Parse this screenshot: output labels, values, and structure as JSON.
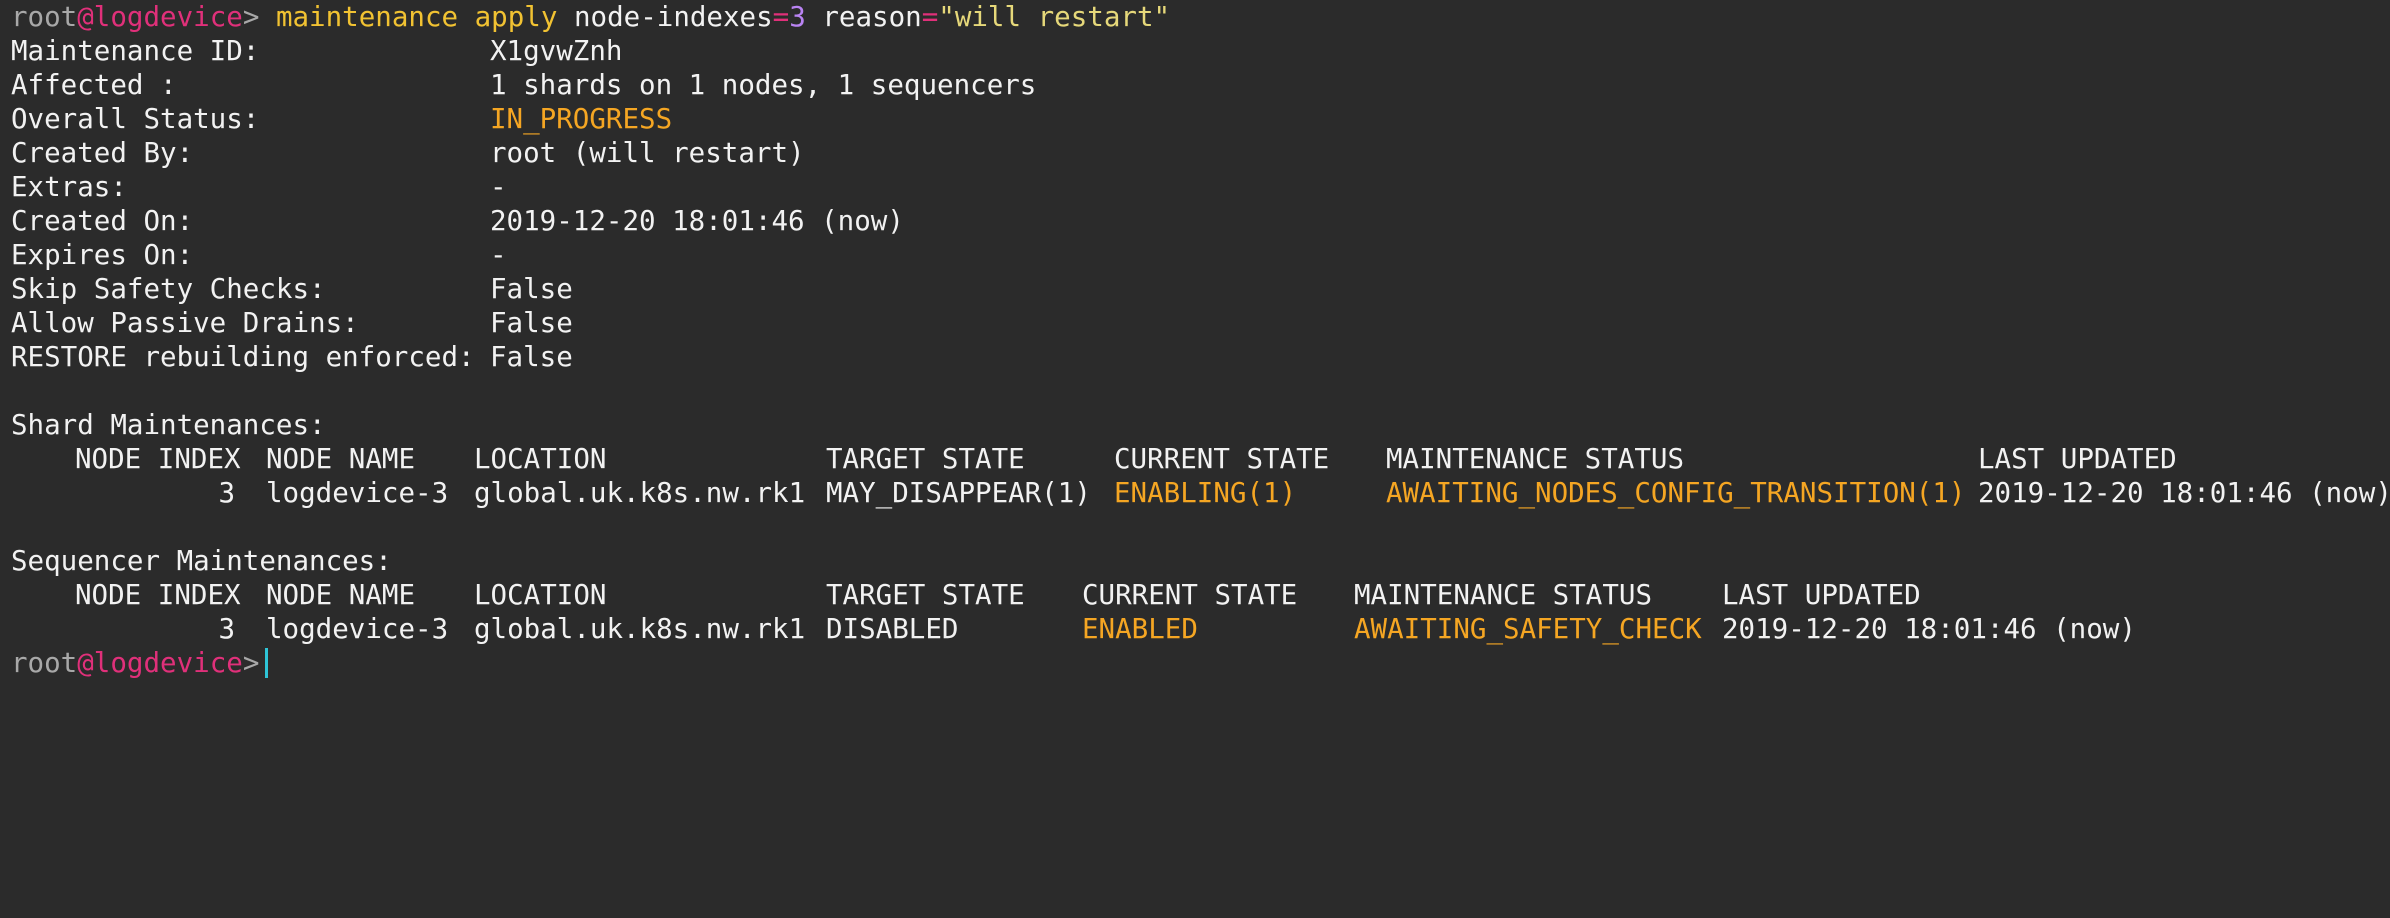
{
  "prompt": {
    "user": "root",
    "at": "@",
    "host": "logdevice",
    "symbol": ">"
  },
  "command": {
    "word1": "maintenance",
    "word2": "apply",
    "arg1_key": "node-indexes",
    "arg1_eq": "=",
    "arg1_val": "3",
    "arg2_key": "reason",
    "arg2_eq": "=",
    "arg2_val": "\"will restart\""
  },
  "details": [
    {
      "label": "Maintenance ID:",
      "value": "X1gvwZnh",
      "highlight": false
    },
    {
      "label": "Affected :",
      "value": "1 shards on 1 nodes, 1 sequencers",
      "highlight": false
    },
    {
      "label": "Overall Status:",
      "value": "IN_PROGRESS",
      "highlight": true
    },
    {
      "label": "Created By:",
      "value": "root (will restart)",
      "highlight": false
    },
    {
      "label": "Extras:",
      "value": "-",
      "highlight": false
    },
    {
      "label": "Created On:",
      "value": "2019-12-20 18:01:46 (now)",
      "highlight": false
    },
    {
      "label": "Expires On:",
      "value": "-",
      "highlight": false
    },
    {
      "label": "Skip Safety Checks:",
      "value": "False",
      "highlight": false
    },
    {
      "label": "Allow Passive Drains:",
      "value": "False",
      "highlight": false
    },
    {
      "label": "RESTORE rebuilding enforced:",
      "value": "False",
      "highlight": false
    }
  ],
  "shard": {
    "title": "Shard Maintenances:",
    "headers": [
      "NODE INDEX",
      "NODE NAME",
      "LOCATION",
      "TARGET STATE",
      "CURRENT STATE",
      "MAINTENANCE STATUS",
      "LAST UPDATED"
    ],
    "row": [
      "3",
      "logdevice-3",
      "global.uk.k8s.nw.rk1",
      "MAY_DISAPPEAR(1)",
      "ENABLING(1)",
      "AWAITING_NODES_CONFIG_TRANSITION(1)",
      "2019-12-20 18:01:46 (now)"
    ]
  },
  "sequencer": {
    "title": "Sequencer Maintenances:",
    "headers": [
      "NODE INDEX",
      "NODE NAME",
      "LOCATION",
      "TARGET STATE",
      "CURRENT STATE",
      "MAINTENANCE STATUS",
      "LAST UPDATED"
    ],
    "row": [
      "3",
      "logdevice-3",
      "global.uk.k8s.nw.rk1",
      "DISABLED",
      "ENABLED",
      "AWAITING_SAFETY_CHECK",
      "2019-12-20 18:01:46 (now)"
    ]
  }
}
